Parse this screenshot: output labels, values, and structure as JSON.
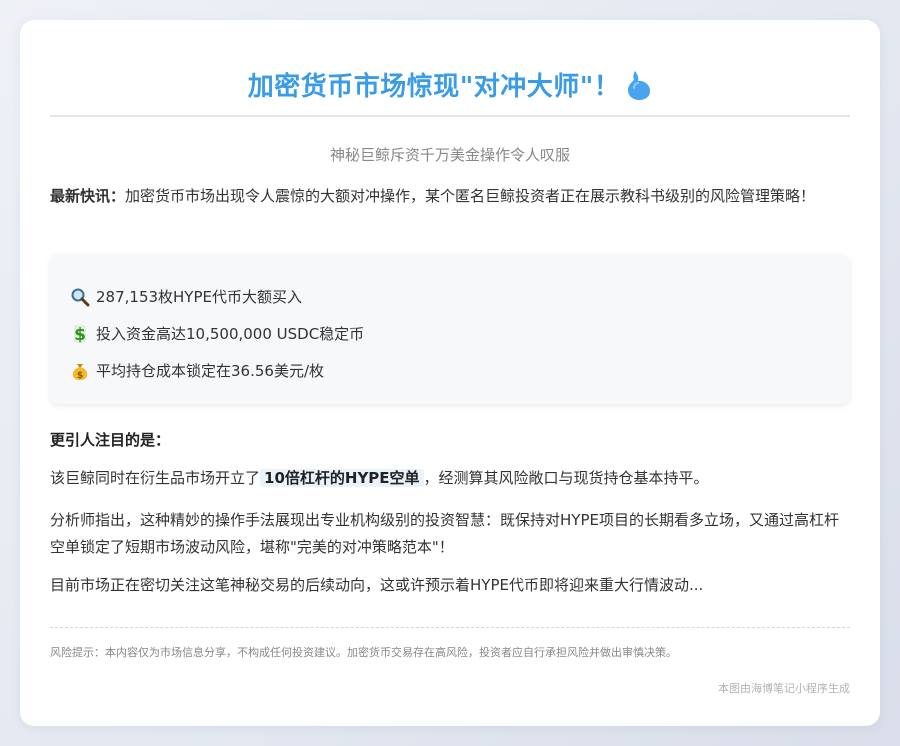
{
  "header": {
    "title": "加密货币市场惊现\"对冲大师\"！",
    "title_icon": "drop-icon",
    "subtitle": "神秘巨鲸斥资千万美金操作令人叹服"
  },
  "lead": {
    "label": "最新快讯：",
    "text": "加密货币市场出现令人震惊的大额对冲操作，某个匿名巨鲸投资者正在展示教科书级别的风险管理策略！"
  },
  "facts": [
    {
      "icon": "magnifier-icon",
      "text": "287,153枚HYPE代币大额买入"
    },
    {
      "icon": "dollar-icon",
      "text": "投入资金高达10,500,000 USDC稳定币"
    },
    {
      "icon": "money-bag-icon",
      "text": "平均持仓成本锁定在36.56美元/枚"
    }
  ],
  "section": {
    "heading": "更引人注目的是："
  },
  "paragraph1": {
    "before": "该巨鲸同时在衍生品市场开立了",
    "highlight": "10倍杠杆的HYPE空单",
    "after": "，经测算其风险敞口与现货持仓基本持平。"
  },
  "paragraph2": "分析师指出，这种精妙的操作手法展现出专业机构级别的投资智慧：既保持对HYPE项目的长期看多立场，又通过高杠杆空单锁定了短期市场波动风险，堪称\"完美的对冲策略范本\"！",
  "paragraph3": "目前市场正在密切关注这笔神秘交易的后续动向，这或许预示着HYPE代币即将迎来重大行情波动...",
  "risk_note": "风险提示：本内容仅为市场信息分享，不构成任何投资建议。加密货币交易存在高风险，投资者应自行承担风险并做出审慎决策。",
  "footer": "本图由海博笔记小程序生成",
  "colors": {
    "title": "#3a9be6",
    "highlight_bg": "#eaf3fc",
    "page_bg": "#e4e8f0"
  }
}
